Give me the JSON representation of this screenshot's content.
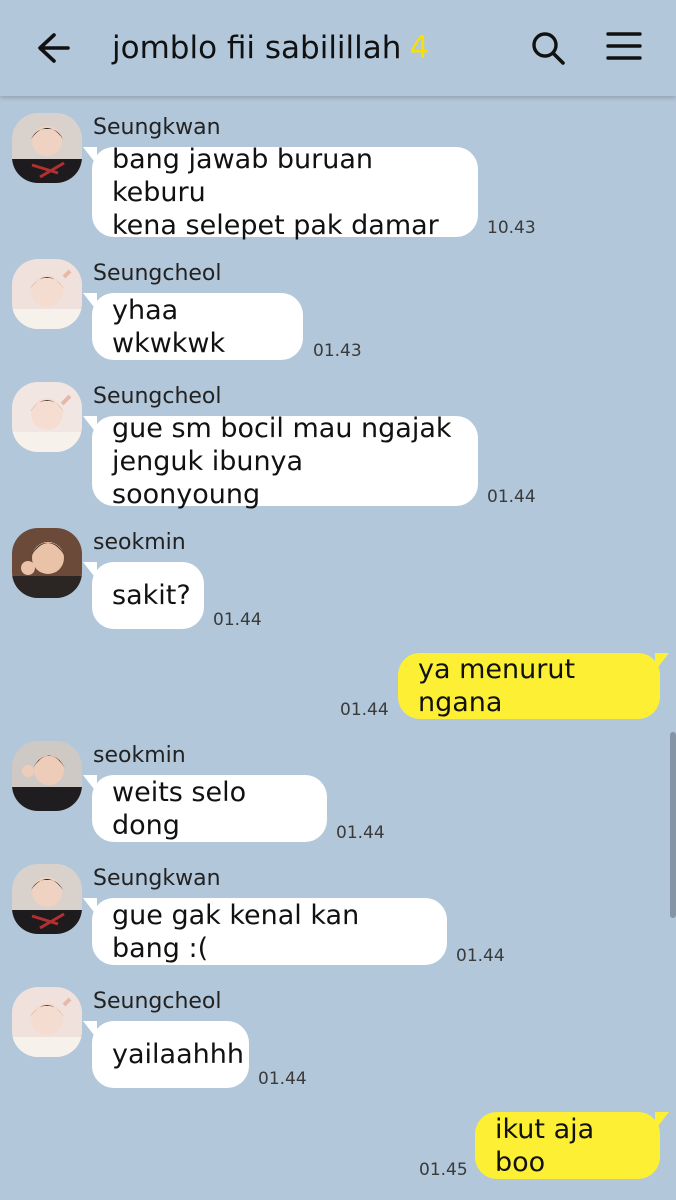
{
  "header": {
    "title": "jomblo fii sabilillah",
    "member_count": "4"
  },
  "messages": [
    {
      "sender": "Seungkwan",
      "text": "bang jawab buruan keburu\nkena selepet pak damar",
      "time": "10.43"
    },
    {
      "sender": "Seungcheol",
      "text": "yhaa wkwkwk",
      "time": "01.43"
    },
    {
      "sender": "Seungcheol",
      "text": "gue sm bocil mau ngajak\njenguk ibunya soonyoung",
      "time": "01.44"
    },
    {
      "sender": "seokmin",
      "text": "sakit?",
      "time": "01.44"
    },
    {
      "text": "ya menurut ngana",
      "time": "01.44"
    },
    {
      "sender": "seokmin",
      "text": "weits selo dong",
      "time": "01.44"
    },
    {
      "sender": "Seungkwan",
      "text": "gue gak kenal kan bang :(",
      "time": "01.44"
    },
    {
      "sender": "Seungcheol",
      "text": "yailaahhh",
      "time": "01.44"
    },
    {
      "text": "ikut aja boo",
      "time": "01.45"
    }
  ],
  "colors": {
    "background": "#b2c7da",
    "outgoing_bubble": "#fdf034",
    "incoming_bubble": "#ffffff",
    "count_accent": "#f9e000"
  },
  "icons": {
    "back": "arrow-left-icon",
    "search": "search-icon",
    "menu": "hamburger-icon"
  }
}
